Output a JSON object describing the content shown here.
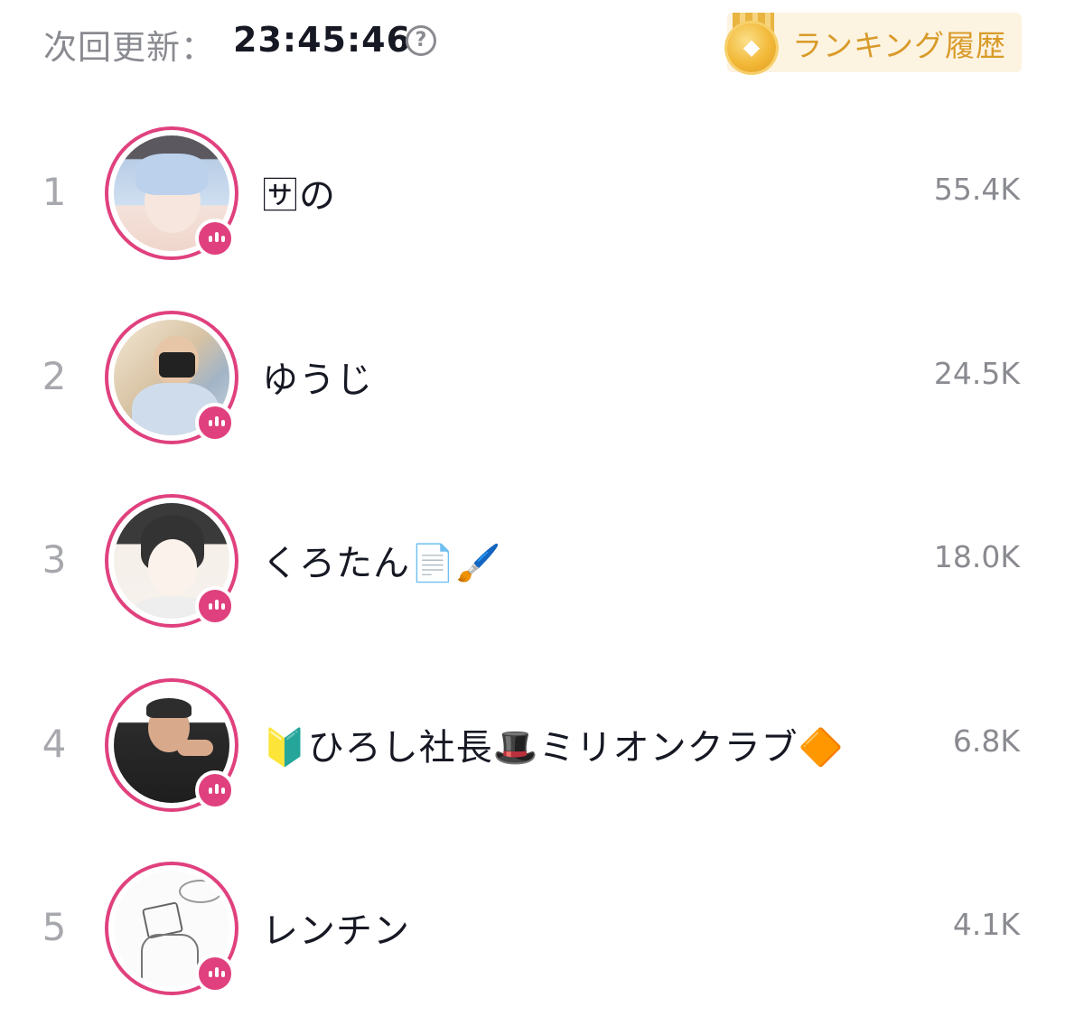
{
  "header": {
    "next_update_label": "次回更新：",
    "timer": "23:45:46",
    "help_icon": "question-circle-icon",
    "history_button_label": "ランキング履歴",
    "history_icon": "gold-medal-icon"
  },
  "colors": {
    "accent_pink": "#e0417e",
    "history_gold": "#d89b2a",
    "history_bg": "#fdf3e1",
    "muted_text": "#8a8b91"
  },
  "ranking": [
    {
      "rank": "1",
      "name": "🈂の",
      "score": "55.4K"
    },
    {
      "rank": "2",
      "name": "ゆうじ",
      "score": "24.5K"
    },
    {
      "rank": "3",
      "name": "くろたん📄🖌️",
      "score": "18.0K"
    },
    {
      "rank": "4",
      "name": "🔰ひろし社長🎩ミリオンクラブ🔶",
      "score": "6.8K"
    },
    {
      "rank": "5",
      "name": "レンチン",
      "score": "4.1K"
    }
  ]
}
